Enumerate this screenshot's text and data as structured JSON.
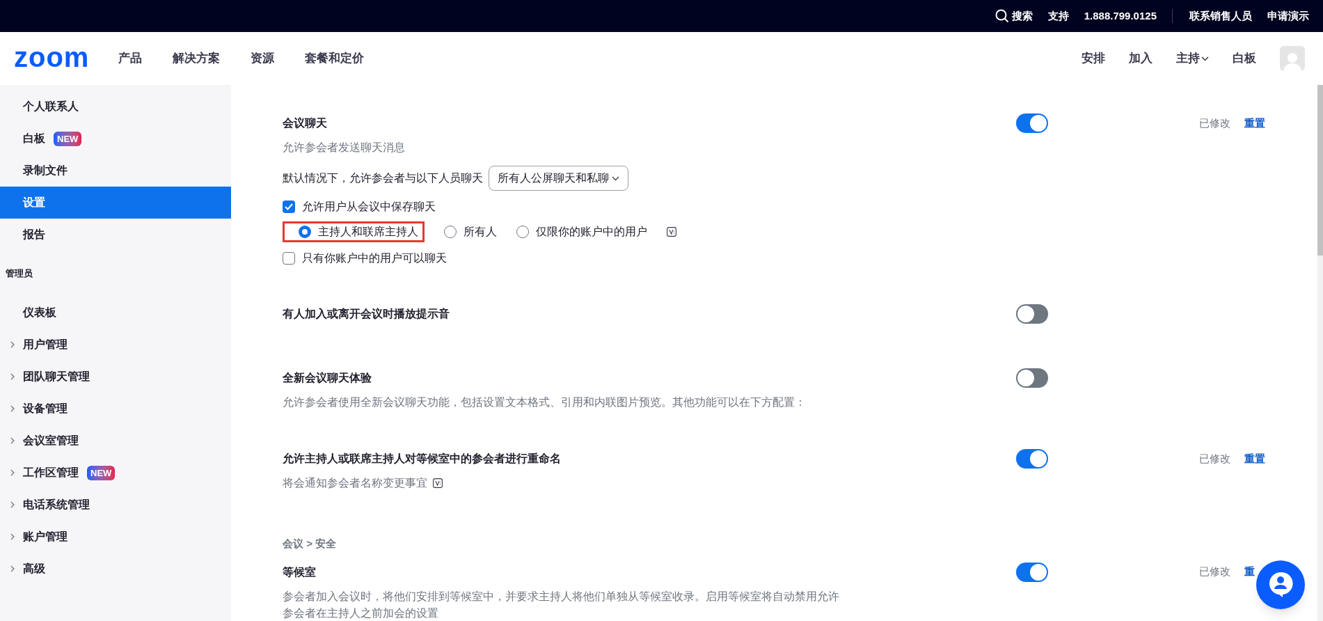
{
  "top_bar": {
    "search": "搜索",
    "links": [
      "支持",
      "1.888.799.0125"
    ],
    "right_links": [
      "联系销售人员",
      "申请演示"
    ]
  },
  "header": {
    "logo": "zoom",
    "nav": [
      "产品",
      "解决方案",
      "资源",
      "套餐和定价"
    ],
    "right_nav": [
      {
        "label": "安排",
        "caret": false
      },
      {
        "label": "加入",
        "caret": false
      },
      {
        "label": "主持",
        "caret": true
      },
      {
        "label": "白板",
        "caret": false
      }
    ]
  },
  "sidebar": {
    "items": [
      {
        "label": "个人联系人",
        "selected": false,
        "expandable": false
      },
      {
        "label": "白板",
        "selected": false,
        "expandable": false,
        "badge": "NEW"
      },
      {
        "label": "录制文件",
        "selected": false,
        "expandable": false
      },
      {
        "label": "设置",
        "selected": true,
        "expandable": false
      },
      {
        "label": "报告",
        "selected": false,
        "expandable": false
      }
    ],
    "admin_heading": "管理员",
    "admin_items": [
      {
        "label": "仪表板",
        "selected": false,
        "expandable": false
      },
      {
        "label": "用户管理",
        "selected": false,
        "expandable": true
      },
      {
        "label": "团队聊天管理",
        "selected": false,
        "expandable": true
      },
      {
        "label": "设备管理",
        "selected": false,
        "expandable": true
      },
      {
        "label": "会议室管理",
        "selected": false,
        "expandable": true
      },
      {
        "label": "工作区管理",
        "selected": false,
        "expandable": true,
        "badge": "NEW"
      },
      {
        "label": "电话系统管理",
        "selected": false,
        "expandable": true
      },
      {
        "label": "账户管理",
        "selected": false,
        "expandable": true
      },
      {
        "label": "高级",
        "selected": false,
        "expandable": true
      }
    ]
  },
  "settings": [
    {
      "kind": "setting",
      "title": "会议聊天",
      "description": "允许参会者发送聊天消息",
      "on": true,
      "modified": "已修改",
      "reset": "重置",
      "options": [
        {
          "kind": "select",
          "label": "默认情况下，允许参会者与以下人员聊天",
          "value": "所有人公屏聊天和私聊"
        },
        {
          "kind": "checkbox",
          "label": "允许用户从会议中保存聊天",
          "checked": true
        },
        {
          "kind": "radios",
          "info_icon": true,
          "options": [
            {
              "label": "主持人和联席主持人",
              "selected": true,
              "highlighted": true
            },
            {
              "label": "所有人",
              "selected": false,
              "highlighted": false
            },
            {
              "label": "仅限你的账户中的用户",
              "selected": false,
              "highlighted": false
            }
          ]
        },
        {
          "kind": "checkbox",
          "label": "只有你账户中的用户可以聊天",
          "checked": false
        }
      ]
    },
    {
      "kind": "setting",
      "title": "有人加入或离开会议时播放提示音",
      "on": false
    },
    {
      "kind": "setting",
      "title": "全新会议聊天体验",
      "description": "允许参会者使用全新会议聊天功能，包括设置文本格式、引用和内联图片预览。其他功能可以在下方配置：",
      "on": false
    },
    {
      "kind": "setting",
      "title": "允许主持人或联席主持人对等候室中的参会者进行重命名",
      "description": "将会通知参会者名称变更事宜",
      "description_icon": true,
      "on": true,
      "modified": "已修改",
      "reset": "重置"
    },
    {
      "kind": "breadcrumb",
      "text": "会议 > 安全"
    },
    {
      "kind": "setting",
      "title": "等候室",
      "description": "参会者加入会议时，将他们安排到等候室中，并要求主持人将他们单独从等候室收录。启用等候室将自动禁用允许参会者在主持人之前加会的设置",
      "on": true,
      "modified": "已修改",
      "reset": "重"
    }
  ]
}
